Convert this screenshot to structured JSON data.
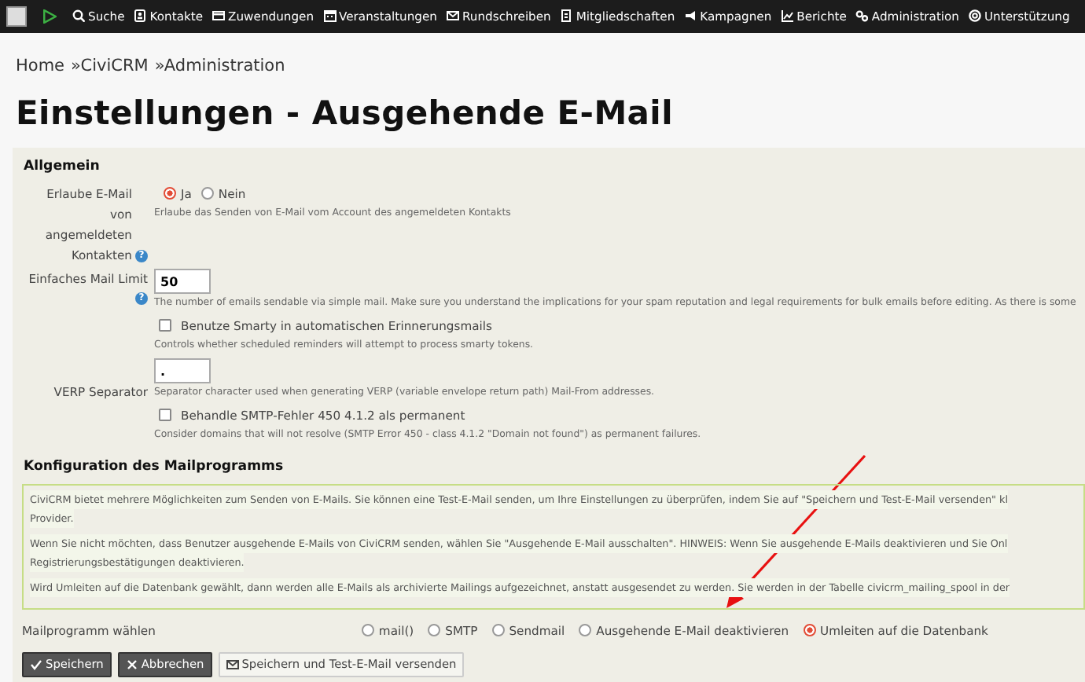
{
  "menu": {
    "items": [
      {
        "kind": "search",
        "label": "Suche"
      },
      {
        "kind": "contacts",
        "label": "Kontakte"
      },
      {
        "kind": "card",
        "label": "Zuwendungen"
      },
      {
        "kind": "calendar",
        "label": "Veranstaltungen"
      },
      {
        "kind": "mail",
        "label": "Rundschreiben"
      },
      {
        "kind": "id",
        "label": "Mitgliedschaften"
      },
      {
        "kind": "megaphone",
        "label": "Kampagnen"
      },
      {
        "kind": "chart",
        "label": "Berichte"
      },
      {
        "kind": "gears",
        "label": "Administration"
      },
      {
        "kind": "lifebuoy",
        "label": "Unterstützung"
      }
    ]
  },
  "breadcrumb": [
    {
      "label": "Home"
    },
    {
      "label": "CiviCRM"
    },
    {
      "label": "Administration"
    }
  ],
  "breadcrumb_separator": "»",
  "title": "Einstellungen - Ausgehende E-Mail",
  "general": {
    "heading": "Allgemein",
    "fields": [
      {
        "kind": "radio",
        "label": "Erlaube E-Mail von angemeldeten Kontakten",
        "help_icon": "?",
        "options": [
          {
            "label": "Ja",
            "selected": true
          },
          {
            "label": "Nein",
            "selected": false
          }
        ],
        "help": "Erlaube das Senden von E-Mail vom Account des angemeldeten Kontakts"
      },
      {
        "kind": "text",
        "label": "Einfaches Mail Limit",
        "help_icon": "?",
        "value": "50",
        "help": "The number of emails sendable via simple mail. Make sure you understand the implications for your spam reputation and legal requirements for bulk emails before editing. As there is some"
      },
      {
        "kind": "checkbox",
        "label": "Benutze Smarty in automatischen Erinnerungsmails",
        "checked": false,
        "help": "Controls whether scheduled reminders will attempt to process smarty tokens."
      },
      {
        "kind": "text",
        "label": "VERP Separator",
        "value": ".",
        "help": "Separator character used when generating VERP (variable envelope return path) Mail-From addresses."
      },
      {
        "kind": "checkbox",
        "label": "Behandle SMTP-Fehler 450 4.1.2 als permanent",
        "checked": false,
        "help": "Consider domains that will not resolve (SMTP Error 450 - class 4.1.2 \"Domain not found\") as permanent failures."
      }
    ]
  },
  "mailer": {
    "heading": "Konfiguration des Mailprogramms",
    "info": [
      [
        "CiviCRM bietet mehrere Möglichkeiten zum Senden von E-Mails. Sie können eine Test-E-Mail senden, um Ihre Einstellungen zu überprüfen, indem Sie auf \"Speichern und Test-E-Mail versenden\" kl",
        "Provider."
      ],
      [
        "Wenn Sie nicht möchten, dass Benutzer ausgehende E-Mails von CiviCRM senden, wählen Sie \"Ausgehende E-Mail ausschalten\". HINWEIS: Wenn Sie ausgehende E-Mails deaktivieren und Sie Onl",
        "Registrierungsbestätigungen deaktivieren."
      ],
      [
        "Wird Umleiten auf die Datenbank gewählt, dann werden alle E-Mails als archivierte Mailings aufgezeichnet, anstatt ausgesendet zu werden. Sie werden in der Tabelle civicrm_mailing_spool in der"
      ]
    ],
    "label": "Mailprogramm wählen",
    "options": [
      {
        "label": "mail()",
        "selected": false
      },
      {
        "label": "SMTP",
        "selected": false
      },
      {
        "label": "Sendmail",
        "selected": false
      },
      {
        "label": "Ausgehende E-Mail deaktivieren",
        "selected": false
      },
      {
        "label": "Umleiten auf die Datenbank",
        "selected": true
      }
    ]
  },
  "buttons": [
    {
      "kind": "check",
      "label": "Speichern"
    },
    {
      "kind": "cross",
      "label": "Abbrechen"
    },
    {
      "kind": "mail",
      "label": "Speichern und Test-E-Mail versenden"
    }
  ]
}
